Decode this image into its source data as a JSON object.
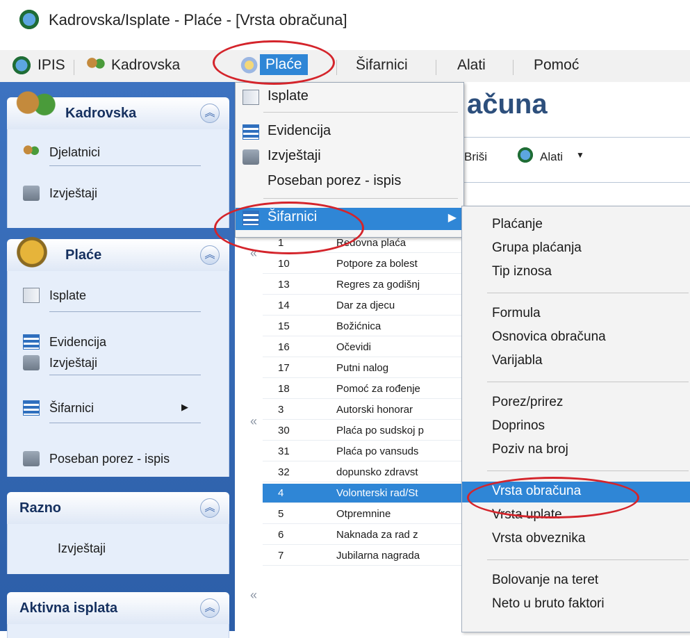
{
  "title_bar": {
    "title": "Kadrovska/Isplate - Plaće - [Vrsta obračuna]"
  },
  "menu_bar": {
    "items": [
      "IPIS",
      "Kadrovska",
      "Plaće",
      "Šifarnici",
      "Alati",
      "Pomoć"
    ]
  },
  "sidebar": {
    "kadrovska": {
      "title": "Kadrovska",
      "items": [
        "Djelatnici",
        "Izvještaji"
      ]
    },
    "place": {
      "title": "Plaće",
      "items": [
        "Isplate",
        "Evidencija",
        "Izvještaji",
        "Šifarnici",
        "Poseban porez - ispis"
      ]
    },
    "razno": {
      "title": "Razno",
      "items": [
        "Izvještaji"
      ]
    },
    "aktivna": {
      "title": "Aktivna isplata"
    }
  },
  "content": {
    "heading": "ačuna",
    "toolbar": {
      "delete": "Briši",
      "tools": "Alati"
    },
    "rows": [
      {
        "code": "1",
        "name": "Redovna plaća"
      },
      {
        "code": "10",
        "name": "Potpore za bolest"
      },
      {
        "code": "13",
        "name": "Regres za godišnj"
      },
      {
        "code": "14",
        "name": "Dar za djecu"
      },
      {
        "code": "15",
        "name": "Božićnica"
      },
      {
        "code": "16",
        "name": "Očevidi"
      },
      {
        "code": "17",
        "name": "Putni nalog"
      },
      {
        "code": "18",
        "name": "Pomoć za rođenje"
      },
      {
        "code": "3",
        "name": "Autorski honorar"
      },
      {
        "code": "30",
        "name": "Plaća po sudskoj p"
      },
      {
        "code": "31",
        "name": "Plaća po vansuds"
      },
      {
        "code": "32",
        "name": "dopunsko zdravst"
      },
      {
        "code": "4",
        "name": "Volonterski rad/St"
      },
      {
        "code": "5",
        "name": "Otpremnine"
      },
      {
        "code": "6",
        "name": "Naknada za rad z"
      },
      {
        "code": "7",
        "name": "Jubilarna nagrada"
      }
    ]
  },
  "place_menu": {
    "items": [
      "Isplate",
      "Evidencija",
      "Izvještaji",
      "Poseban porez - ispis",
      "Šifarnici"
    ]
  },
  "sifarnici_submenu": {
    "items": [
      "Plaćanje",
      "Grupa plaćanja",
      "Tip iznosa",
      "Formula",
      "Osnovica obračuna",
      "Varijabla",
      "Porez/prirez",
      "Doprinos",
      "Poziv na broj",
      "Vrsta obračuna",
      "Vrsta uplate",
      "Vrsta obveznika",
      "Bolovanje na teret",
      "Neto u bruto faktori"
    ]
  },
  "colors": {
    "selection": "#2f86d6",
    "highlight_ring": "#d4242b",
    "sidebar": "#3d73c0"
  }
}
